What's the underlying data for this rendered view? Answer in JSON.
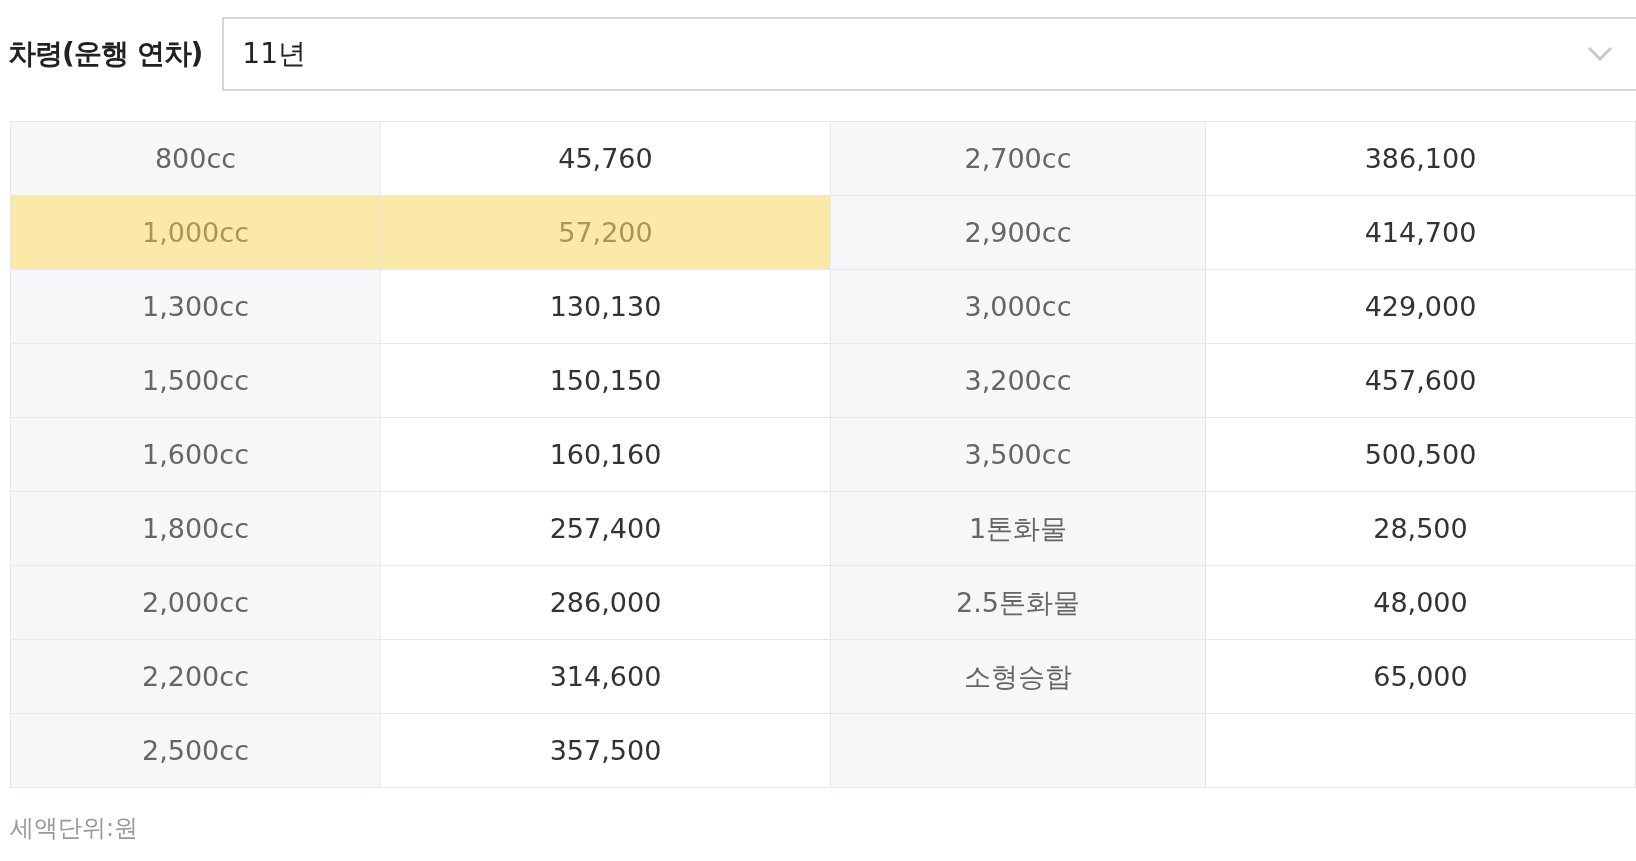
{
  "filter": {
    "label": "차령(운행 연차)",
    "value": "11년"
  },
  "table": {
    "rows": [
      {
        "left": {
          "engine": "800cc",
          "tax": "45,760",
          "highlighted": false
        },
        "right": {
          "engine": "2,700cc",
          "tax": "386,100",
          "highlighted": false
        }
      },
      {
        "left": {
          "engine": "1,000cc",
          "tax": "57,200",
          "highlighted": true
        },
        "right": {
          "engine": "2,900cc",
          "tax": "414,700",
          "highlighted": false
        }
      },
      {
        "left": {
          "engine": "1,300cc",
          "tax": "130,130",
          "highlighted": false
        },
        "right": {
          "engine": "3,000cc",
          "tax": "429,000",
          "highlighted": false
        }
      },
      {
        "left": {
          "engine": "1,500cc",
          "tax": "150,150",
          "highlighted": false
        },
        "right": {
          "engine": "3,200cc",
          "tax": "457,600",
          "highlighted": false
        }
      },
      {
        "left": {
          "engine": "1,600cc",
          "tax": "160,160",
          "highlighted": false
        },
        "right": {
          "engine": "3,500cc",
          "tax": "500,500",
          "highlighted": false
        }
      },
      {
        "left": {
          "engine": "1,800cc",
          "tax": "257,400",
          "highlighted": false
        },
        "right": {
          "engine": "1톤화물",
          "tax": "28,500",
          "highlighted": false
        }
      },
      {
        "left": {
          "engine": "2,000cc",
          "tax": "286,000",
          "highlighted": false
        },
        "right": {
          "engine": "2.5톤화물",
          "tax": "48,000",
          "highlighted": false
        }
      },
      {
        "left": {
          "engine": "2,200cc",
          "tax": "314,600",
          "highlighted": false
        },
        "right": {
          "engine": "소형승합",
          "tax": "65,000",
          "highlighted": false
        }
      },
      {
        "left": {
          "engine": "2,500cc",
          "tax": "357,500",
          "highlighted": false
        }
      }
    ]
  },
  "footnote": "세액단위:원"
}
